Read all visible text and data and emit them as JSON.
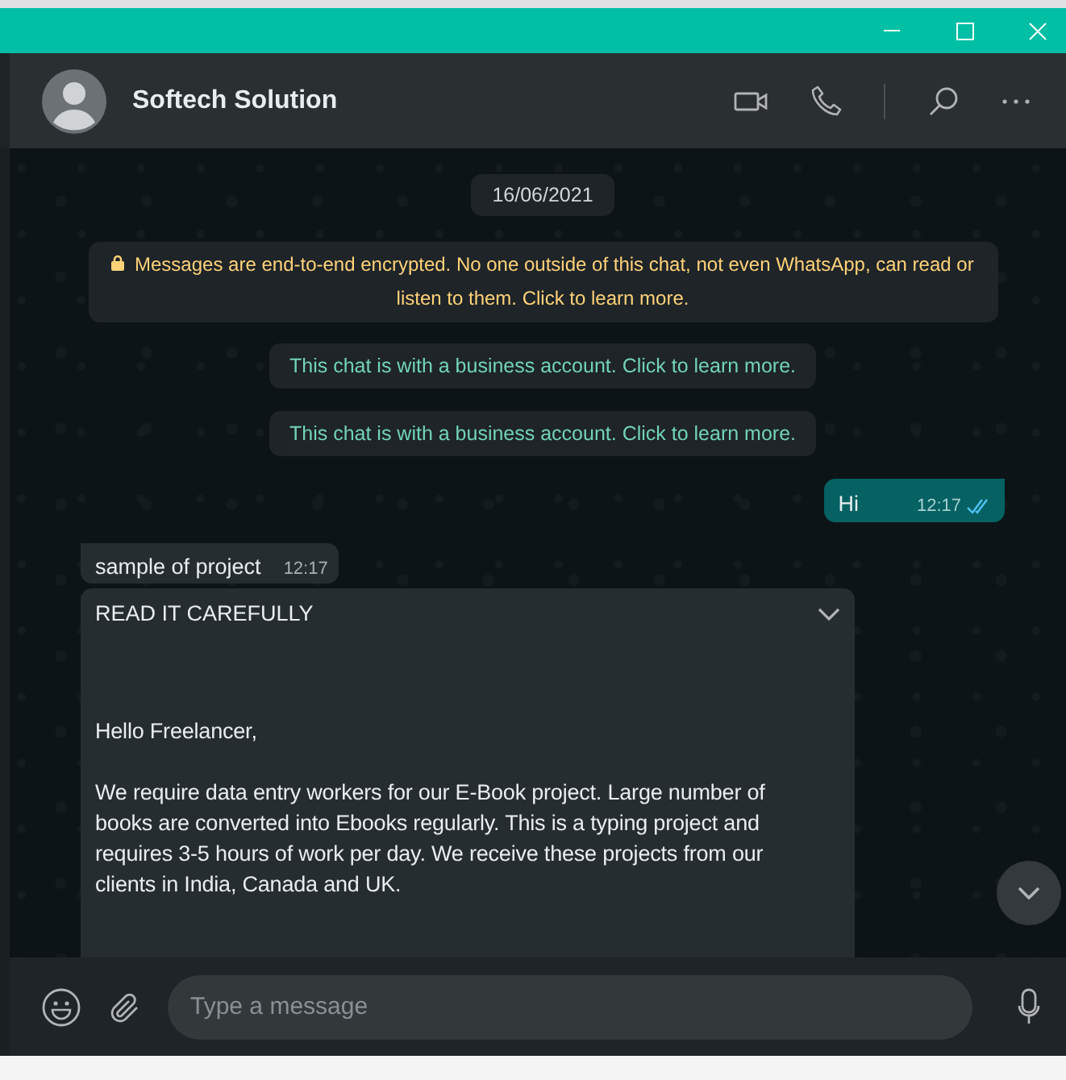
{
  "contact": {
    "name": "Softech Solution"
  },
  "messages": [
    {
      "kind": "date",
      "text": "16/06/2021"
    },
    {
      "kind": "encryption",
      "text": "Messages are end-to-end encrypted. No one outside of this chat, not even WhatsApp, can read or listen to them. Click to learn more."
    },
    {
      "kind": "notice",
      "text": "This chat is with a business account. Click to learn more."
    },
    {
      "kind": "notice",
      "text": "This chat is with a business account. Click to learn more."
    },
    {
      "kind": "outgoing",
      "text": "Hi",
      "time": "12:17",
      "read": true
    },
    {
      "kind": "incoming",
      "text": "sample of project",
      "time": "12:17"
    },
    {
      "kind": "long",
      "title": "READ IT CAREFULLY",
      "paragraphs": [
        "Hello Freelancer,",
        "We require data entry workers for our E-Book project. Large number of books are converted into Ebooks regularly. This is a typing project and requires 3-5 hours of work per day. We receive these projects from our clients in India, Canada and UK."
      ]
    }
  ],
  "composer": {
    "placeholder": "Type a message"
  }
}
